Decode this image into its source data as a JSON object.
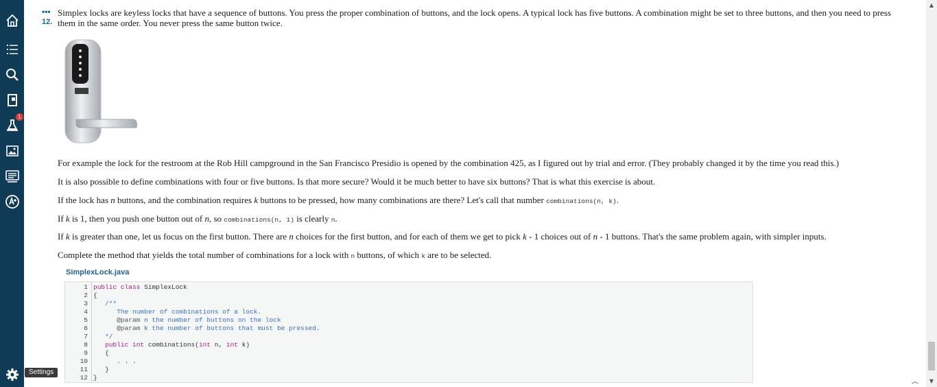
{
  "problem": {
    "dots": "•••",
    "number": "12.",
    "intro": "Simplex locks are keyless locks that have a sequence of buttons. You press the proper combination of buttons, and the lock opens. A typical lock has five buttons. A combination might be set to three buttons, and then you need to press them in the same order. You never press the same button twice."
  },
  "paragraphs": {
    "p1": "For example the lock for the restroom at the Rob Hill campground in the San Francisco Presidio is opened by the combination 425, as I figured out by trial and error. (They probably changed it by the time you read this.)",
    "p2": "It is also possible to define combinations with four or five buttons. Is that more secure? Would it be much better to have six buttons? That is what this exercise is about.",
    "p3": {
      "a": "If the lock has ",
      "n": "n",
      "b": " buttons, and the combination requires ",
      "k": "k",
      "c": " buttons to be pressed, how many combinations are there? Let's call that number ",
      "code": "combinations(n, k)",
      "d": "."
    },
    "p4": {
      "a": "If ",
      "k": "k",
      "b": " is 1, then you push one button out of ",
      "n": "n",
      "c": ", so ",
      "code": "combinations(n, 1)",
      "d": " is clearly ",
      "code2": "n",
      "e": "."
    },
    "p5": {
      "a": "If ",
      "k": "k",
      "b": " is greater than one, let us focus on the first button. There are ",
      "n": "n",
      "c": " choices for the first button, and for each of them we get to pick ",
      "k2": "k",
      "d": " - 1 choices out of ",
      "n2": "n",
      "e": " - 1 buttons. That's the same problem again, with simpler inputs."
    },
    "p6": {
      "a": "Complete the method that yields the total number of combinations for a lock with ",
      "code": "n",
      "b": " buttons, of which ",
      "code2": "k",
      "c": " are to be selected."
    }
  },
  "code": {
    "file_name": "SimplexLock.java",
    "lines": [
      {
        "n": "1",
        "kw": "public class",
        "rest": " SimplexLock"
      },
      {
        "n": "2",
        "text": "{"
      },
      {
        "n": "3",
        "comment": "   /**"
      },
      {
        "n": "4",
        "comment": "      The number of combinations of a lock."
      },
      {
        "n": "5",
        "param": "      @param",
        "comment": " n the number of buttons on the lock"
      },
      {
        "n": "6",
        "param": "      @param",
        "comment": " k the number of buttons that must be pressed."
      },
      {
        "n": "7",
        "comment": "   */"
      },
      {
        "n": "8",
        "kw": "   public int",
        "rest": " combinations(",
        "kw2": "int",
        "rest2": " n, ",
        "kw3": "int",
        "rest3": " k)"
      },
      {
        "n": "9",
        "text": "   {"
      },
      {
        "n": "10",
        "text": "      . . ."
      },
      {
        "n": "11",
        "text": "   }"
      },
      {
        "n": "12",
        "text": "}"
      }
    ]
  },
  "sidebar": {
    "items": [
      "home-icon",
      "list-icon",
      "search-icon",
      "exit-door-icon",
      "lab-flask-icon",
      "image-icon",
      "notes-icon",
      "accessibility-icon"
    ],
    "badge_count": "1",
    "settings_tooltip": "Settings"
  },
  "colors": {
    "sidebar_bg": "#0f3b57",
    "accent": "#0e6a8c",
    "file_title": "#1f5f93",
    "keyword": "#a11d86",
    "comment": "#3a6fbf"
  }
}
